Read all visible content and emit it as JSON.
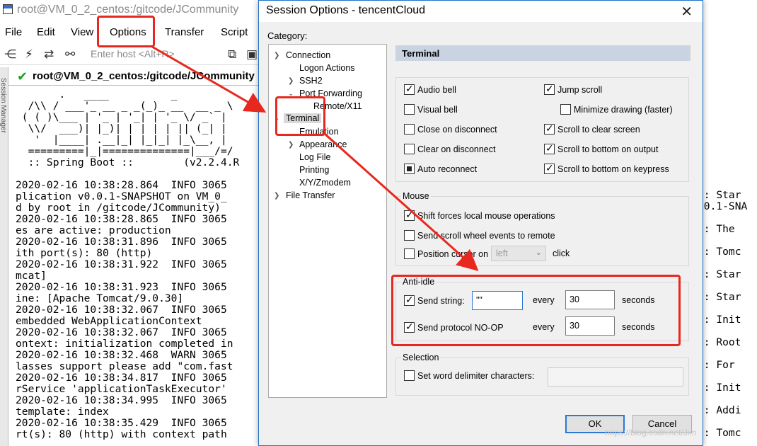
{
  "bg_app": {
    "title": "root@VM_0_2_centos:/gitcode/JCommunity",
    "menu": [
      "File",
      "Edit",
      "View",
      "Options",
      "Transfer",
      "Script"
    ],
    "host_placeholder": "Enter host <Alt+R>",
    "tab_label": "root@VM_0_2_centos:/gitcode/JCommunity",
    "side_label": "Session Manager",
    "terminal_lines": [
      "       .   ____          _",
      "  /\\\\ / ___'_ __ _ _(_)_ __  __ _ \\",
      " ( ( )\\___ | '_ | '_| | '_ \\/ _` |",
      "  \\\\/  ___)| |_)| | | | | || (_| |",
      "   '  |____| .__|_| |_|_| |_\\__, |",
      "  =========|_|==============|___/=/",
      "  :: Spring Boot ::        (v2.2.4.R",
      "",
      "2020-02-16 10:38:28.864  INFO 3065",
      "plication v0.0.1-SNAPSHOT on VM_0_",
      "d by root in /gitcode/JCommunity)",
      "2020-02-16 10:38:28.865  INFO 3065",
      "es are active: production",
      "2020-02-16 10:38:31.896  INFO 3065",
      "ith port(s): 80 (http)",
      "2020-02-16 10:38:31.922  INFO 3065",
      "mcat]",
      "2020-02-16 10:38:31.923  INFO 3065",
      "ine: [Apache Tomcat/9.0.30]",
      "2020-02-16 10:38:32.067  INFO 3065",
      "embedded WebApplicationContext",
      "2020-02-16 10:38:32.067  INFO 3065",
      "ontext: initialization completed in",
      "2020-02-16 10:38:32.468  WARN 3065",
      "lasses support please add \"com.fast",
      "2020-02-16 10:38:34.817  INFO 3065",
      "rService 'applicationTaskExecutor'",
      "2020-02-16 10:38:34.995  INFO 3065",
      "template: index",
      "2020-02-16 10:38:35.429  INFO 3065",
      "rt(s): 80 (http) with context path"
    ],
    "terminal_right_lines": [
      " : Star",
      ".0.1-SNA",
      "",
      " : The",
      "",
      " : Tomc",
      "",
      " : Star",
      "",
      " : Star",
      "",
      " : Init",
      "",
      " : Root",
      "",
      " : For",
      "",
      " : Init",
      "",
      " : Addi",
      "",
      " : Tomc"
    ]
  },
  "dialog": {
    "title": "Session Options - tencentCloud",
    "category_label": "Category:",
    "tree": {
      "connection": "Connection",
      "logon_actions": "Logon Actions",
      "ssh2": "SSH2",
      "port_forwarding": "Port Forwarding",
      "remote_x11": "Remote/X11",
      "terminal": "Terminal",
      "emulation": "Emulation",
      "appearance": "Appearance",
      "log_file": "Log File",
      "printing": "Printing",
      "xyzmodem": "X/Y/Zmodem",
      "file_transfer": "File Transfer"
    },
    "panel_header": "Terminal",
    "options": {
      "audio_bell": "Audio bell",
      "jump_scroll": "Jump scroll",
      "visual_bell": "Visual bell",
      "minimize_drawing": "Minimize drawing (faster)",
      "close_on_disconnect": "Close on disconnect",
      "scroll_to_clear": "Scroll to clear screen",
      "clear_on_disconnect": "Clear on disconnect",
      "scroll_bottom_output": "Scroll to bottom on output",
      "auto_reconnect": "Auto reconnect",
      "scroll_bottom_keypress": "Scroll to bottom on keypress"
    },
    "mouse": {
      "title": "Mouse",
      "shift_forces": "Shift forces local mouse operations",
      "send_scroll": "Send scroll wheel events to remote",
      "position_cursor": "Position cursor on",
      "position_value": "left",
      "click": "click"
    },
    "anti_idle": {
      "title": "Anti-idle",
      "send_string_label": "Send string:",
      "send_string_value": "\"\"",
      "every1": "every",
      "interval1": "30",
      "seconds1": "seconds",
      "noop_label": "Send protocol NO-OP",
      "every2": "every",
      "interval2": "30",
      "seconds2": "seconds"
    },
    "selection": {
      "title": "Selection",
      "word_delim": "Set word delimiter characters:"
    },
    "ok": "OK",
    "cancel": "Cancel"
  },
  "watermark": "https://blog.csdn.net/Jim",
  "annotation_color": "#e8281e"
}
